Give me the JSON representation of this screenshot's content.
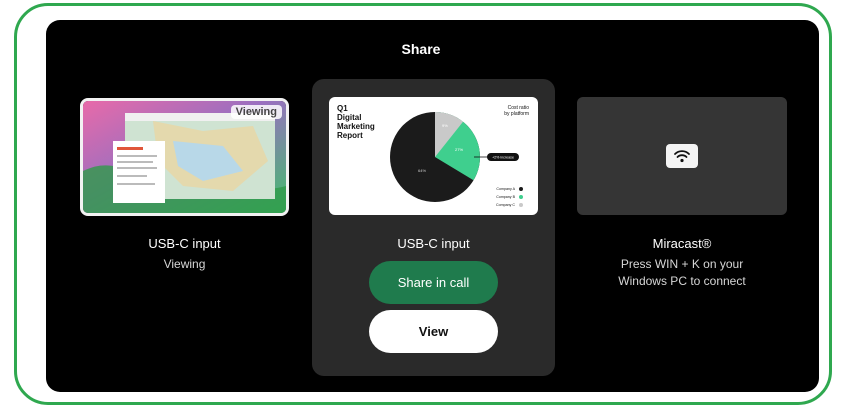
{
  "dialog": {
    "title": "Share"
  },
  "sources": [
    {
      "name": "USB-C input",
      "status": "Viewing",
      "badge": "Viewing"
    },
    {
      "name": "USB-C input",
      "preview": {
        "title_lines": [
          "Q1",
          "Digital",
          "Marketing",
          "Report"
        ],
        "cost_ratio_lines": [
          "Cost ratio",
          "by platform"
        ],
        "callout": "+2% increase",
        "legend": [
          "Company A",
          "Company B",
          "Company C"
        ],
        "slice_labels": [
          "64%",
          "27%",
          "9%"
        ]
      },
      "buttons": {
        "share": "Share in call",
        "view": "View"
      }
    },
    {
      "name": "Miracast®",
      "instructions": [
        "Press WIN + K on your",
        "Windows PC to connect"
      ]
    }
  ],
  "colors": {
    "accent": "#1f7b4d",
    "highlight_border": "#2fa84f",
    "slice_a": "#1b1b1b",
    "slice_b": "#3fcf8e",
    "slice_c": "#c9c9c9"
  }
}
